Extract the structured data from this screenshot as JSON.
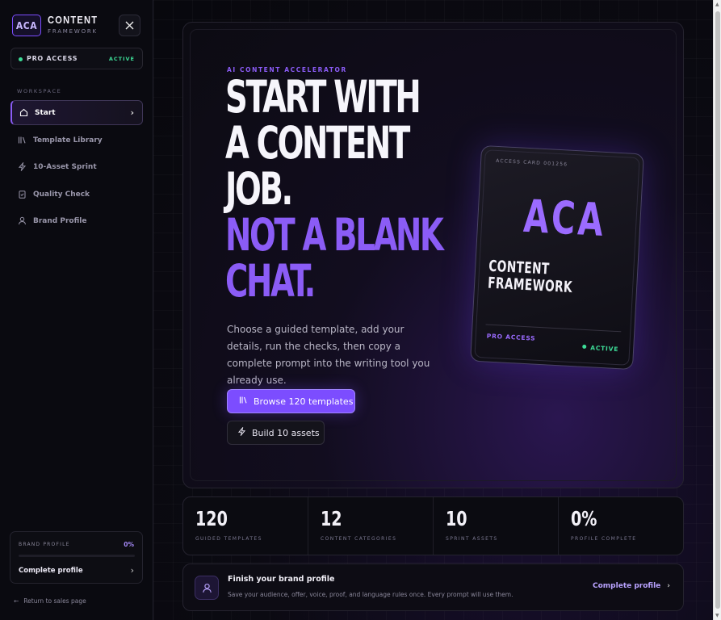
{
  "sidebar": {
    "logo_text": "ACA",
    "brand_title": "CONTENT",
    "brand_subtitle": "FRAMEWORK",
    "plan_label": "PRO ACCESS",
    "plan_status": "ACTIVE",
    "section_label": "WORKSPACE",
    "items": [
      {
        "label": "Start",
        "icon": "home-icon",
        "active": true
      },
      {
        "label": "Template Library",
        "icon": "library-icon"
      },
      {
        "label": "10-Asset Sprint",
        "icon": "lightning-icon"
      },
      {
        "label": "Quality Check",
        "icon": "clipboard-check-icon"
      },
      {
        "label": "Brand Profile",
        "icon": "user-icon"
      }
    ],
    "brand_profile": {
      "label": "BRAND PROFILE",
      "percent": "0%",
      "progress": 0,
      "action": "Complete profile"
    },
    "return_link": "Return to sales page"
  },
  "hero": {
    "kicker": "AI CONTENT ACCELERATOR",
    "headline_line1": "START WITH",
    "headline_line2": "A CONTENT",
    "headline_line3": "JOB.",
    "headline_line4": "NOT A BLANK",
    "headline_line5": "CHAT.",
    "lead": "Choose a guided template, add your details, run the checks, then copy a complete prompt into the writing tool you already use.",
    "primary_button": "Browse 120 templates",
    "secondary_button": "Build 10 assets"
  },
  "card": {
    "serial": "ACCESS CARD 001256",
    "big_text": "ACA",
    "title_line1": "CONTENT",
    "title_line2": "FRAMEWORK",
    "plan": "PRO ACCESS",
    "status": "ACTIVE"
  },
  "stats": [
    {
      "value": "120",
      "label": "GUIDED TEMPLATES"
    },
    {
      "value": "12",
      "label": "CONTENT CATEGORIES"
    },
    {
      "value": "10",
      "label": "SPRINT ASSETS"
    },
    {
      "value": "0%",
      "label": "PROFILE COMPLETE"
    }
  ],
  "finish": {
    "title": "Finish your brand profile",
    "description": "Save your audience, offer, voice, proof, and language rules once. Every prompt will use them.",
    "action": "Complete profile"
  },
  "colors": {
    "accent": "#8b5cf6",
    "success": "#3ddc97",
    "background": "#07070c"
  }
}
